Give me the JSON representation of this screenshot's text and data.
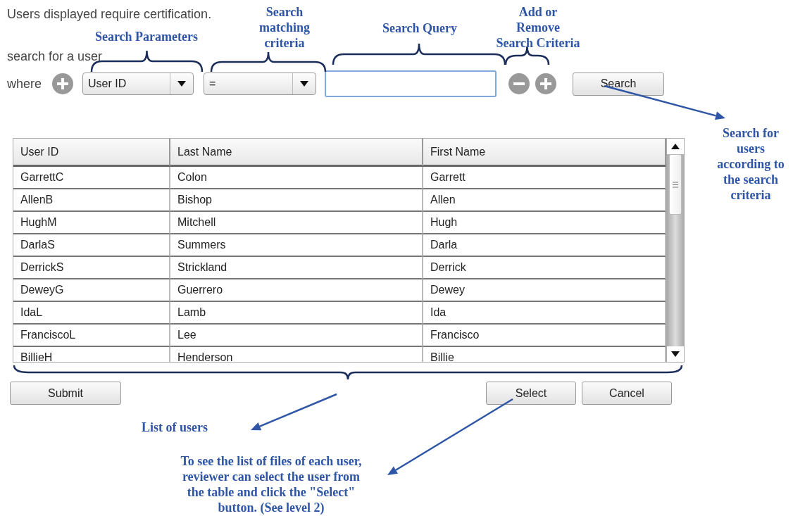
{
  "intro": "Users displayed require certification.",
  "search_label": "search for a user",
  "criteria": {
    "where_label": "where",
    "field": "User ID",
    "operator": "=",
    "search_button": "Search"
  },
  "table": {
    "columns": [
      "User ID",
      "Last Name",
      "First Name"
    ],
    "rows": [
      [
        "GarrettC",
        "Colon",
        "Garrett"
      ],
      [
        "AllenB",
        "Bishop",
        "Allen"
      ],
      [
        "HughM",
        "Mitchell",
        "Hugh"
      ],
      [
        "DarlaS",
        "Summers",
        "Darla"
      ],
      [
        "DerrickS",
        "Strickland",
        "Derrick"
      ],
      [
        "DeweyG",
        "Guerrero",
        "Dewey"
      ],
      [
        "IdaL",
        "Lamb",
        "Ida"
      ],
      [
        "FranciscoL",
        "Lee",
        "Francisco"
      ],
      [
        "BillieH",
        "Henderson",
        "Billie"
      ]
    ]
  },
  "footer_buttons": [
    {
      "label": "Submit",
      "kind": "left"
    },
    {
      "label": "Select",
      "kind": "right"
    },
    {
      "label": "Cancel",
      "kind": "right"
    }
  ],
  "annotations": [
    {
      "text": "Search Parameters",
      "kind": "brace"
    },
    {
      "text": "Search\nmatching\ncriteria",
      "kind": "brace"
    },
    {
      "text": "Search Query",
      "kind": "brace"
    },
    {
      "text": "Add or\nRemove\nSearch Criteria",
      "kind": "brace"
    },
    {
      "text": "Search for\nusers\naccording to\nthe search\ncriteria",
      "kind": "arrow"
    },
    {
      "text": "List of users",
      "kind": "brace-arrow"
    },
    {
      "text": "To see the list of files of each user,\nreviewer can select the user from\nthe table and click the \"Select\"\nbutton.  (See level 2)",
      "kind": "arrow"
    }
  ]
}
